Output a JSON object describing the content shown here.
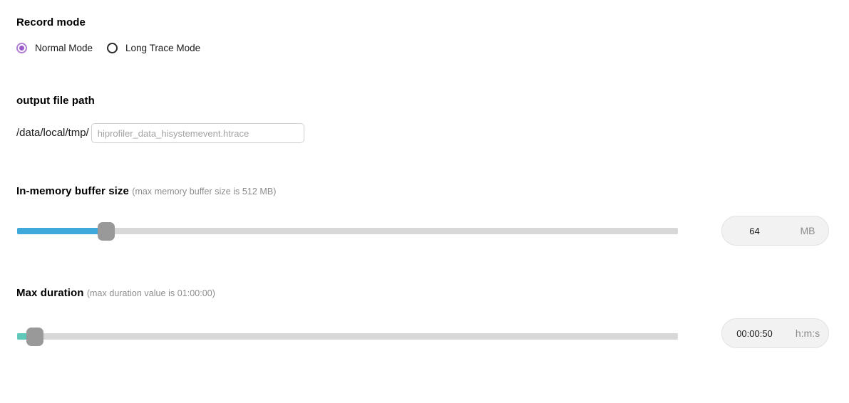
{
  "record_mode": {
    "title": "Record mode",
    "options": [
      {
        "label": "Normal Mode",
        "selected": true
      },
      {
        "label": "Long Trace Mode",
        "selected": false
      }
    ],
    "selected_color": "#9b59c9"
  },
  "output_file_path": {
    "title": "output file path",
    "prefix": "/data/local/tmp/",
    "input_value": "",
    "input_placeholder": "hiprofiler_data_hisystemevent.htrace"
  },
  "buffer_size": {
    "title": "In-memory buffer size",
    "hint": "(max memory buffer size is 512 MB)",
    "value": "64",
    "unit": "MB",
    "slider_percent": 12.5,
    "fill_color": "#3fa9dc",
    "track_color": "#d8d8d8",
    "thumb_color": "#999999"
  },
  "max_duration": {
    "title": "Max duration",
    "hint": "(max duration value is 01:00:00)",
    "value": "00:00:50",
    "unit": "h:m:s",
    "slider_percent": 1.4,
    "fill_color": "#5fc8b8",
    "track_color": "#d8d8d8",
    "thumb_color": "#999999"
  }
}
